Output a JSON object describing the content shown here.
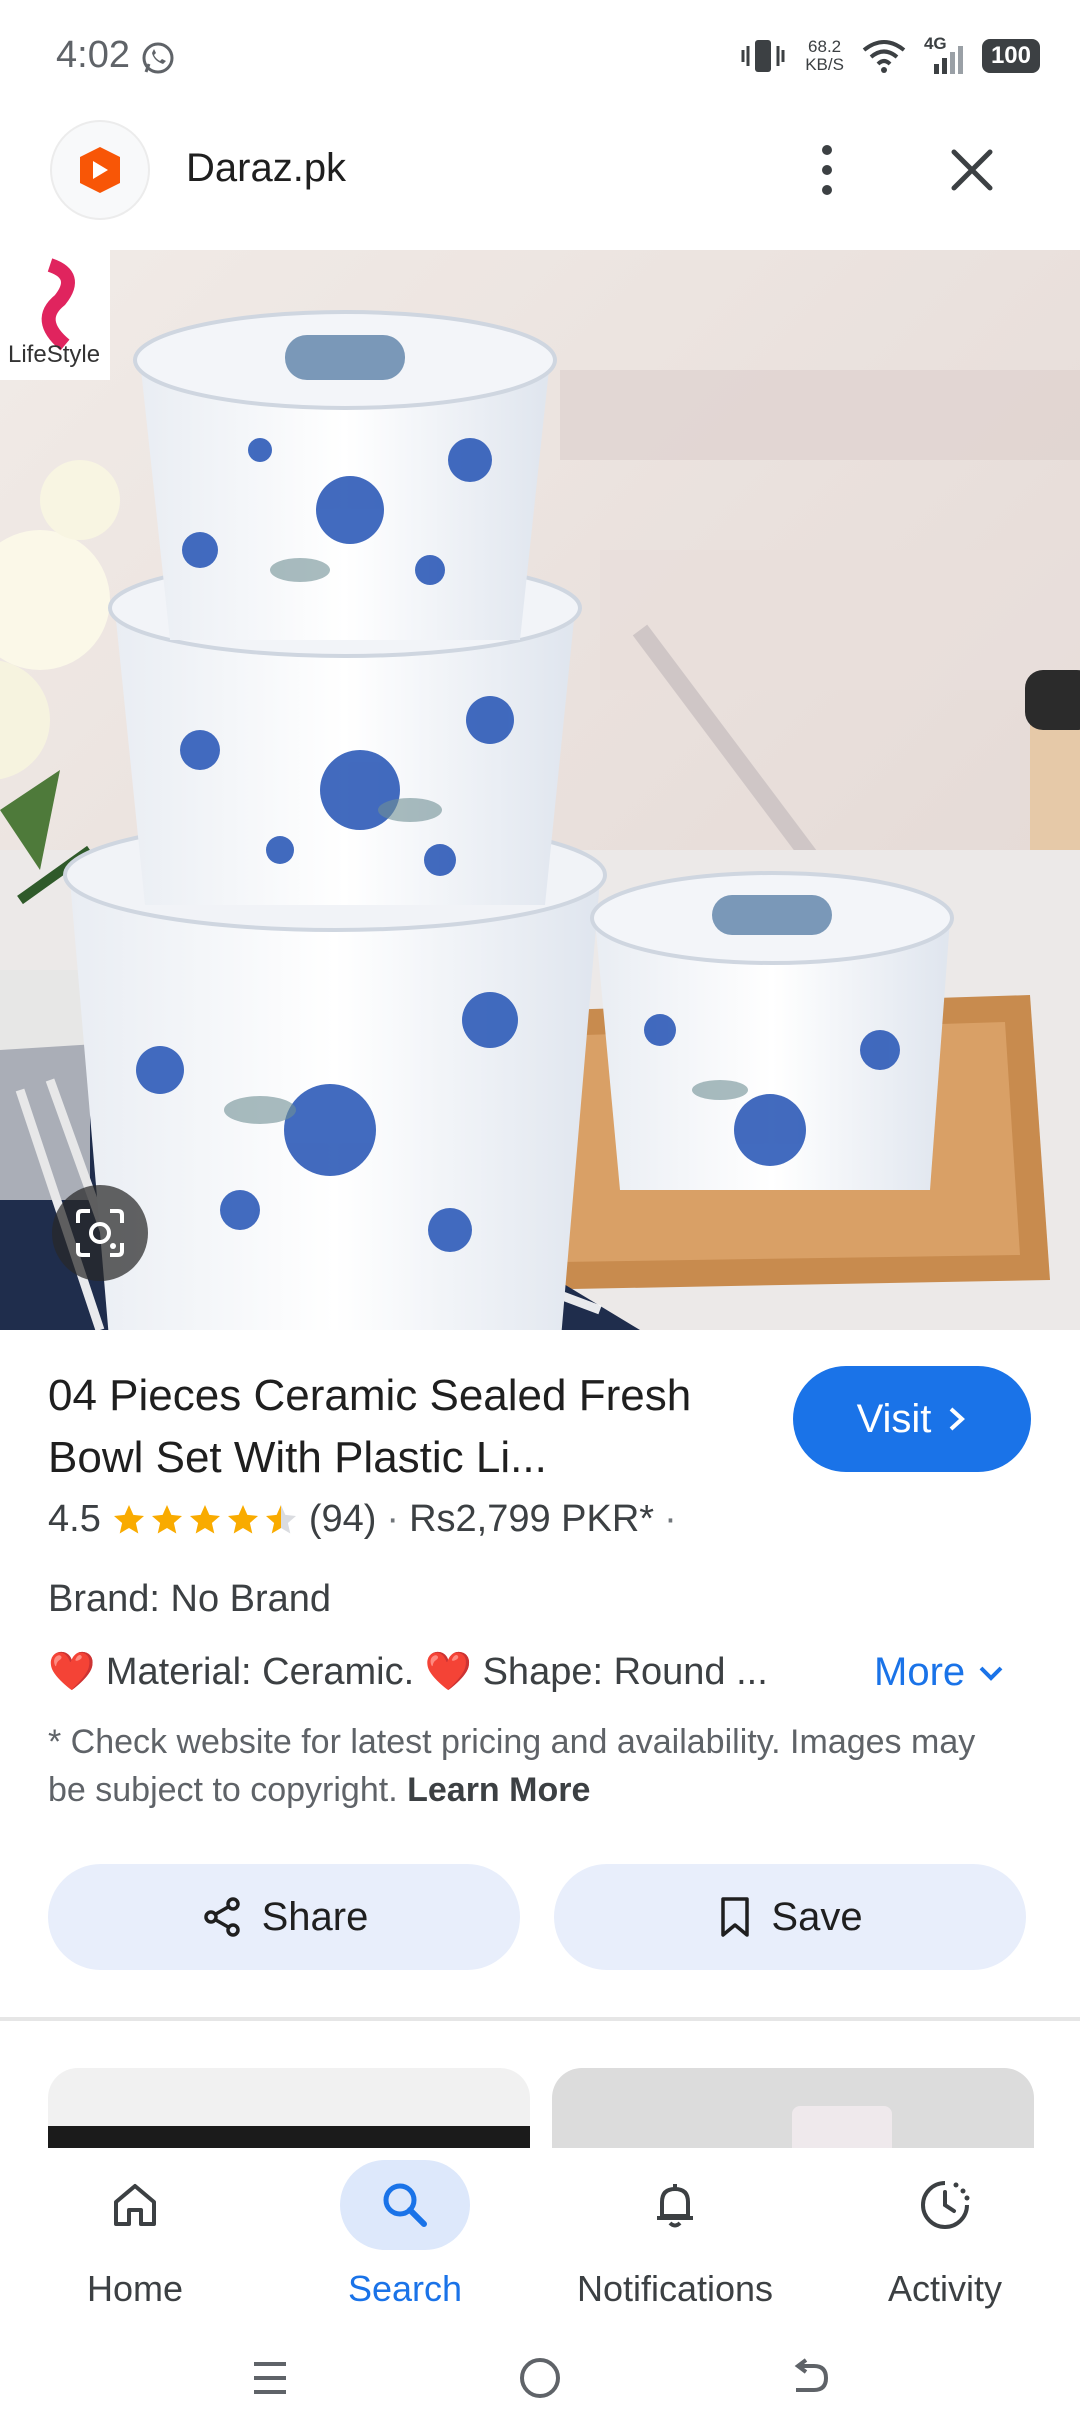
{
  "status_bar": {
    "time": "4:02",
    "net_speed_top": "68.2",
    "net_speed_unit": "KB/S",
    "network_type": "4G",
    "battery": "100"
  },
  "header": {
    "site_name": "Daraz.pk",
    "site_icon": "daraz-logo-icon",
    "menu_icon": "more-vert-icon",
    "close_icon": "close-icon"
  },
  "image": {
    "watermark_text": "LifeStyle",
    "lens_icon": "google-lens-icon"
  },
  "product": {
    "title": "04 Pieces Ceramic Sealed Fresh Bowl Set With Plastic Li...",
    "visit_label": "Visit",
    "rating": "4.5",
    "rating_value": 4.5,
    "review_count": "(94)",
    "separator": "·",
    "price": "Rs2,799 PKR*",
    "brand": "Brand: No Brand",
    "features": "❤️ Material: Ceramic. ❤️ Shape: Round ...",
    "more_label": "More",
    "disclaimer": "* Check website for latest pricing and availability. Images may be subject to copyright.",
    "learn_more": "Learn More"
  },
  "actions": {
    "share_label": "Share",
    "save_label": "Save"
  },
  "bottom_nav": [
    {
      "label": "Home",
      "icon": "home-icon",
      "active": false
    },
    {
      "label": "Search",
      "icon": "search-icon",
      "active": true
    },
    {
      "label": "Notifications",
      "icon": "bell-icon",
      "active": false
    },
    {
      "label": "Activity",
      "icon": "activity-icon",
      "active": false
    }
  ],
  "colors": {
    "accent": "#1a73e8",
    "pill_bg": "#e8eefb",
    "star": "#f9ab00",
    "daraz_orange": "#f85606"
  }
}
